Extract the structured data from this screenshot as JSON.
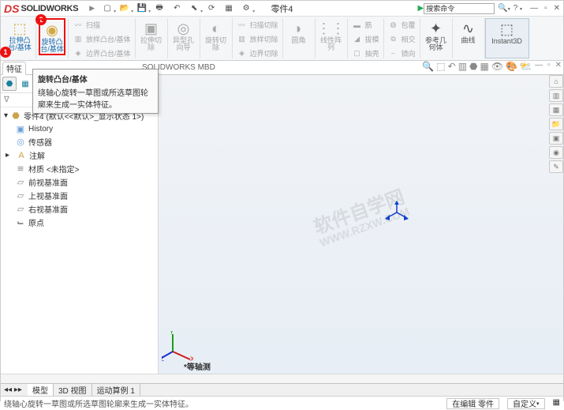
{
  "app": {
    "logo_text": "SOLIDWORKS",
    "doc_title": "零件4"
  },
  "search": {
    "placeholder": "搜索命令"
  },
  "qat": [
    "new",
    "open",
    "save",
    "print",
    "undo",
    "select",
    "rebuild",
    "options",
    "settings"
  ],
  "ribbon": {
    "extrude": {
      "label1": "拉伸凸",
      "label2": "台/基体"
    },
    "revolve": {
      "label1": "旋转凸",
      "label2": "台/基体"
    },
    "sweep": "扫描",
    "loft": "放样凸台/基体",
    "boundary": "边界凸台/基体",
    "cut_ext": {
      "label1": "拉伸切",
      "label2": "除"
    },
    "hole": {
      "label1": "异型孔",
      "label2": "向导"
    },
    "cut_rev": {
      "label1": "旋转切",
      "label2": "除"
    },
    "cut_sweep": "扫描切除",
    "cut_loft": "放样切除",
    "cut_boundary": "边界切除",
    "fillet": "圆角",
    "pattern": {
      "label1": "线性阵",
      "label2": "列"
    },
    "rib": "筋",
    "draft": "拔模",
    "shell": "抽壳",
    "wrap": "包覆",
    "intersect": "相交",
    "mirror": "镜向",
    "refgeo": {
      "label1": "参考几",
      "label2": "何体"
    },
    "curve": "曲线",
    "instant3d": "Instant3D"
  },
  "tabs": {
    "features": "特征",
    "mbd": "SOLIDWORKS MBD"
  },
  "tooltip": {
    "title": "旋转凸台/基体",
    "body": "绕轴心旋转一草图或所选草图轮廓来生成一实体特征。"
  },
  "tree": {
    "root": "零件4 (默认<<默认>_显示状态 1>)",
    "history": "History",
    "sensors": "传感器",
    "annotations": "注解",
    "material": "材质 <未指定>",
    "front": "前视基准面",
    "top": "上视基准面",
    "right": "右视基准面",
    "origin": "原点"
  },
  "viewport": {
    "label": "*等轴测"
  },
  "bottom_tabs": {
    "model": "模型",
    "view3d": "3D 视图",
    "motion": "运动算例 1"
  },
  "status": {
    "hint": "绕轴心旋转一草图或所选草图轮廓来生成一实体特征。",
    "editing": "在编辑 零件",
    "custom": "自定义"
  },
  "watermark": {
    "l1": "软件自学网",
    "l2": "WWW.RZXW.COM"
  },
  "badges": {
    "one": "1",
    "two": "2"
  }
}
